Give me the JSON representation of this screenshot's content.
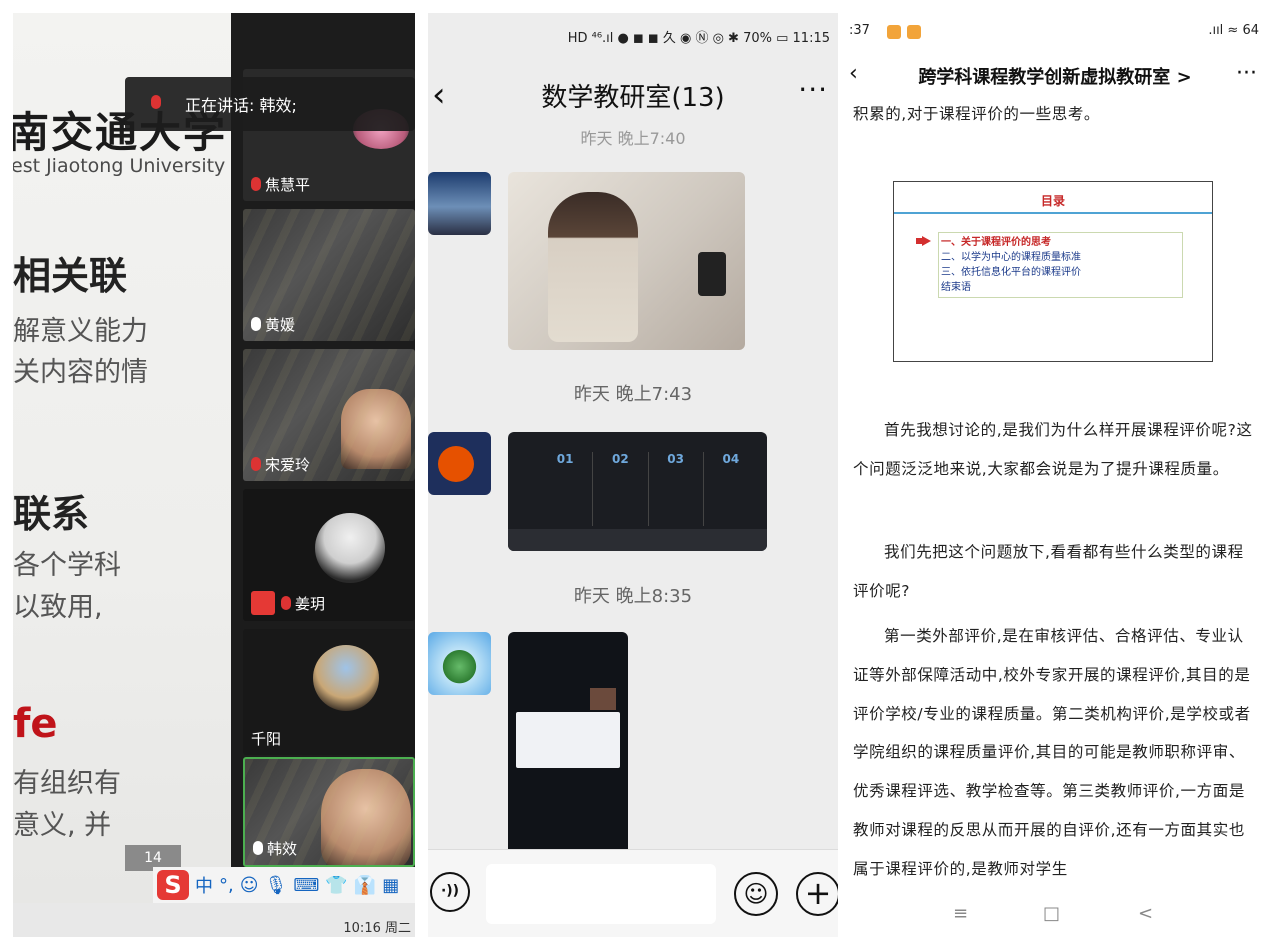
{
  "conference": {
    "speaking_banner": "正在讲话: 韩效;",
    "university_cn": "南交通大学",
    "university_en": "est Jiaotong University",
    "slide_lines": [
      "相关联",
      "解意义能力",
      "关内容的情",
      "联系",
      "各个学科",
      "以致用,",
      "fe",
      "有组织有",
      "意义, 并"
    ],
    "participants": [
      "焦慧平",
      "黄媛",
      "宋爱玲",
      "姜玥",
      "千阳",
      "韩效"
    ],
    "page_number": "14",
    "ime_chars": [
      "中",
      "°,",
      "☺",
      "🎙",
      "⌨",
      "👕",
      "👔",
      "▦"
    ],
    "clock": "10:16 周二"
  },
  "chat": {
    "status_text": "HD ⁴⁶.ıl ● ◼ ◼ 久 ◉ Ⓝ ◎ ✱ 70% ▭ 11:15",
    "title": "数学教研室(13)",
    "timestamps": [
      "昨天 晚上7:40",
      "昨天 晚上7:43",
      "昨天 晚上8:35"
    ],
    "screenshot1": {
      "numbers": [
        "01",
        "02",
        "03",
        "04"
      ]
    }
  },
  "article": {
    "status_time": ":37",
    "status_right": ".ııl ≈ 64",
    "title": "跨学科课程教学创新虚拟教研室",
    "title_suffix": ">",
    "more": "···",
    "top_line": "积累的,对于课程评价的一些思考。",
    "toc_title": "目录",
    "toc_items": [
      "一、关于课程评价的思考",
      "二、以学为中心的课程质量标准",
      "三、依托信息化平台的课程评价",
      "结束语"
    ],
    "paragraphs": [
      "首先我想讨论的,是我们为什么样开展课程评价呢?这个问题泛泛地来说,大家都会说是为了提升课程质量。",
      "我们先把这个问题放下,看看都有些什么类型的课程评价呢?",
      "第一类外部评价,是在审核评估、合格评估、专业认证等外部保障活动中,校外专家开展的课程评价,其目的是评价学校/专业的课程质量。第二类机构评价,是学校或者学院组织的课程质量评价,其目的可能是教师职称评审、优秀课程评选、教学检查等。第三类教师评价,一方面是教师对课程的反思从而开展的自评价,还有一方面其实也属于课程评价的,是教师对学生"
    ],
    "nav": [
      "≡",
      "□",
      "<"
    ]
  }
}
